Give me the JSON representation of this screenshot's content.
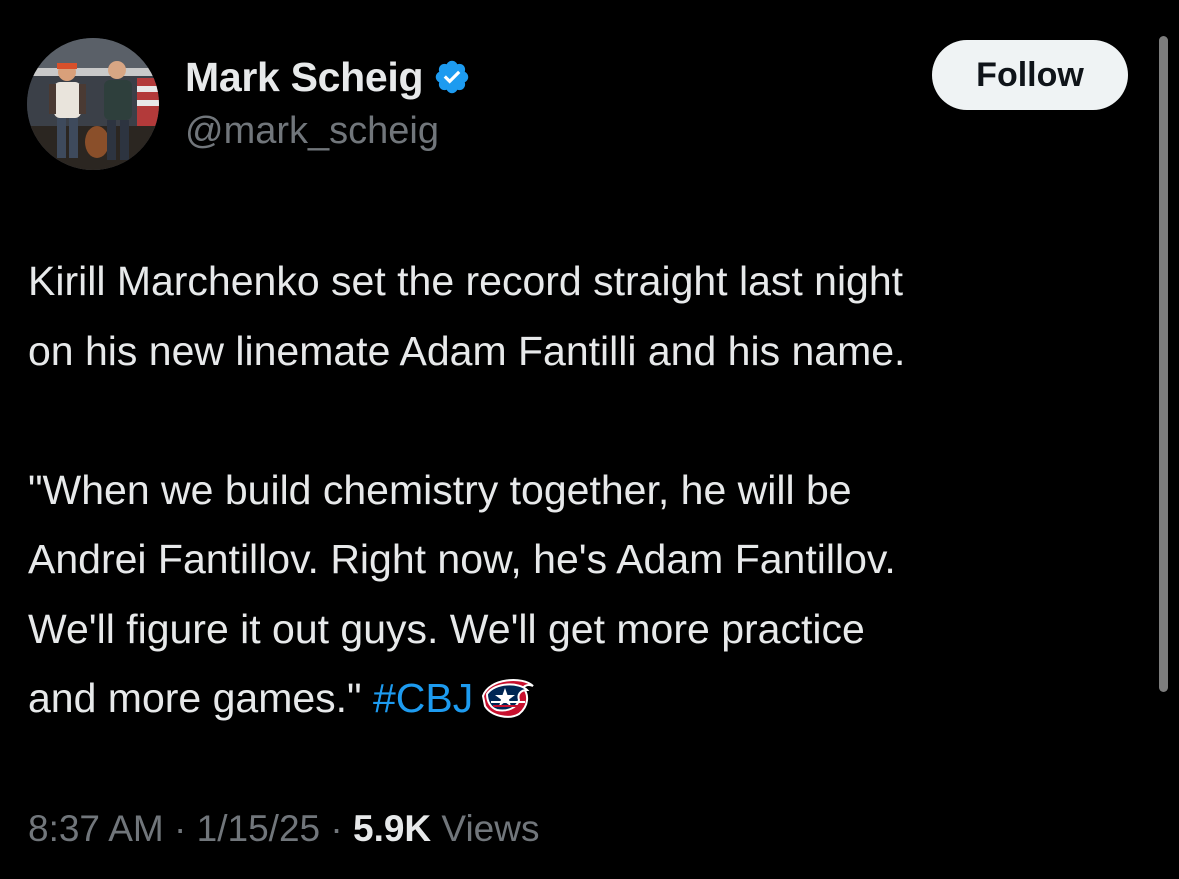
{
  "author": {
    "display_name": "Mark Scheig",
    "handle": "@mark_scheig",
    "verified": true,
    "avatar_icon": "profile-photo"
  },
  "follow_button": {
    "label": "Follow"
  },
  "tweet": {
    "lines_p1": [
      "Kirill Marchenko set the record straight last night",
      "on his new linemate Adam Fantilli and his name."
    ],
    "lines_p2": [
      "\"When we build chemistry together, he will be",
      "Andrei Fantillov. Right now, he's Adam Fantillov.",
      "We'll figure it out guys. We'll get more practice"
    ],
    "last_line_text": "and more games.\" ",
    "hashtag": "#CBJ",
    "hashtag_emoji_icon": "columbus-blue-jackets-logo"
  },
  "meta": {
    "time": "8:37 AM",
    "separator": " · ",
    "date": "1/15/25",
    "views_count": "5.9K",
    "views_label": " Views"
  },
  "colors": {
    "background": "#000000",
    "text": "#e7e9ea",
    "muted": "#71767b",
    "link": "#1d9bf0",
    "verified": "#1d9bf0",
    "follow_bg": "#eff3f4"
  }
}
